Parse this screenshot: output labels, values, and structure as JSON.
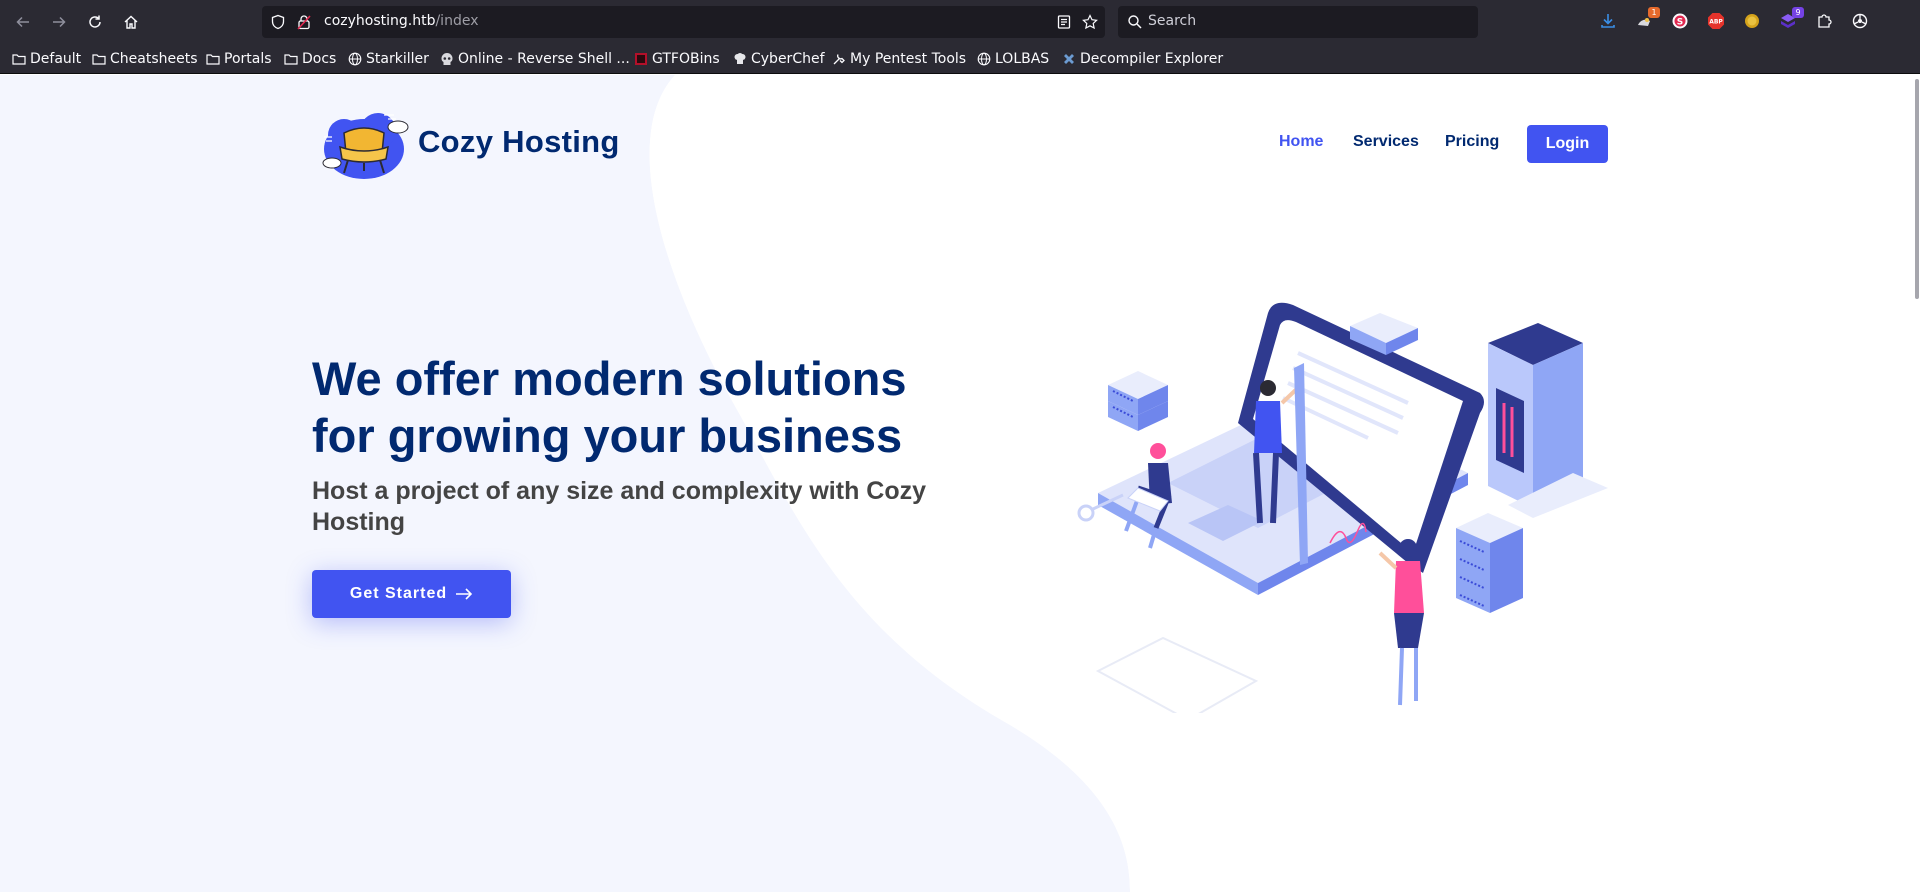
{
  "browser": {
    "url_host": "cozyhosting.htb",
    "url_path": "/index",
    "search_placeholder": "Search",
    "extensions": [
      {
        "name": "downloads-icon"
      },
      {
        "name": "extension-dog-icon",
        "badge": "1",
        "badge_color": "#e66a2c"
      },
      {
        "name": "extension-s-icon"
      },
      {
        "name": "adblock-plus-icon",
        "text": "ABP"
      },
      {
        "name": "extension-coin-icon"
      },
      {
        "name": "extension-shield-icon",
        "badge": "9",
        "badge_color": "#7542e5"
      },
      {
        "name": "extensions-puzzle-icon"
      },
      {
        "name": "extension-wheel-icon"
      }
    ],
    "bookmarks": [
      {
        "label": "Default",
        "icon": "folder-icon"
      },
      {
        "label": "Cheatsheets",
        "icon": "folder-icon"
      },
      {
        "label": "Portals",
        "icon": "folder-icon"
      },
      {
        "label": "Docs",
        "icon": "folder-icon"
      },
      {
        "label": "Starkiller",
        "icon": "globe-icon"
      },
      {
        "label": "Online - Reverse Shell ...",
        "icon": "skull-icon"
      },
      {
        "label": "GTFOBins",
        "icon": "gtfobins-icon"
      },
      {
        "label": "CyberChef",
        "icon": "chef-hat-icon"
      },
      {
        "label": "My Pentest Tools",
        "icon": "tools-icon"
      },
      {
        "label": "LOLBAS",
        "icon": "globe-icon"
      },
      {
        "label": "Decompiler Explorer",
        "icon": "dogbolt-icon"
      }
    ]
  },
  "site": {
    "brand": "Cozy Hosting",
    "nav": {
      "home": "Home",
      "services": "Services",
      "pricing": "Pricing",
      "login": "Login"
    },
    "hero": {
      "title": "We offer modern solutions for growing your business",
      "subtitle": "Host a project of any size and complexity with Cozy Hosting",
      "cta": "Get Started"
    }
  },
  "colors": {
    "accent": "#4154f1",
    "heading": "#012970",
    "body_text": "#444444",
    "hero_background": "#f4f6fe",
    "browser_chrome": "#2b2a33"
  }
}
